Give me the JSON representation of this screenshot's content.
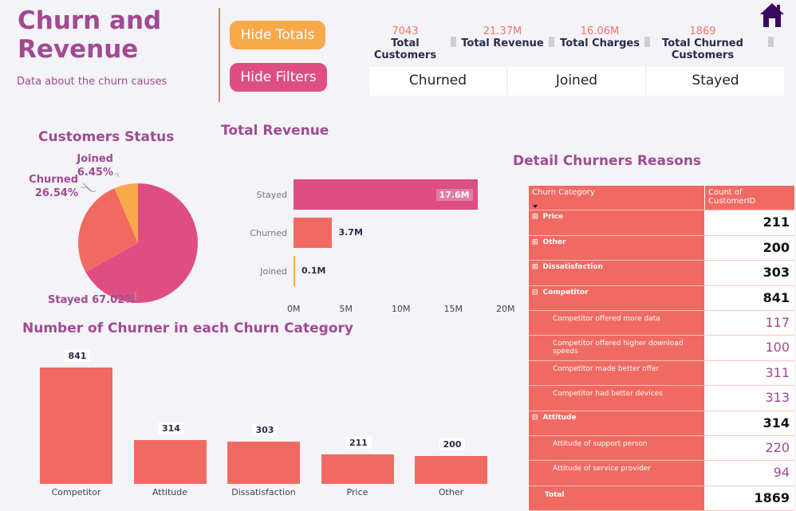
{
  "header": {
    "title": "Churn and Revenue",
    "subtitle": "Data about the churn causes",
    "hide_totals": "Hide Totals",
    "hide_filters": "Hide Filters",
    "home_icon": "home-icon"
  },
  "kpis": [
    {
      "value": "7043",
      "label": "Total Customers"
    },
    {
      "value": "21.37M",
      "label": "Total Revenue"
    },
    {
      "value": "16.06M",
      "label": "Total Charges"
    },
    {
      "value": "1869",
      "label": "Total Churned Customers"
    }
  ],
  "slicer": [
    "Churned",
    "Joined",
    "Stayed"
  ],
  "colors": {
    "accent": "#a04a93",
    "coral": "#f06a62",
    "pink": "#de4e83",
    "orange": "#f8a94a"
  },
  "chart_data": [
    {
      "type": "pie",
      "title": "Customers Status",
      "slices": [
        {
          "label": "Stayed",
          "value": 67.02,
          "display": "67.02%",
          "color": "#de4e83"
        },
        {
          "label": "Churned",
          "value": 26.54,
          "display": "26.54%",
          "color": "#f06a62"
        },
        {
          "label": "Joined",
          "value": 6.45,
          "display": "6.45%",
          "color": "#f8a94a"
        }
      ]
    },
    {
      "type": "bar",
      "orientation": "horizontal",
      "title": "Total Revenue",
      "categories": [
        "Stayed",
        "Churned",
        "Joined"
      ],
      "values": [
        17.6,
        3.7,
        0.1
      ],
      "labels": [
        "17.6M",
        "3.7M",
        "0.1M"
      ],
      "colors": [
        "#de4e83",
        "#f06a62",
        "#f8a94a"
      ],
      "xlim": [
        0,
        20
      ],
      "xticks": [
        "0M",
        "5M",
        "10M",
        "15M",
        "20M"
      ]
    },
    {
      "type": "bar",
      "title": "Number of Churner in each Churn Category",
      "categories": [
        "Competitor",
        "Attitude",
        "Dissatisfaction",
        "Price",
        "Other"
      ],
      "values": [
        841,
        314,
        303,
        211,
        200
      ]
    },
    {
      "type": "table",
      "title": "Detail Churners Reasons",
      "columns": [
        "Churn Category",
        "Count of CustomerID"
      ],
      "rows": [
        {
          "label": "Price",
          "value": "211",
          "level": "top",
          "toggle": "⊞"
        },
        {
          "label": "Other",
          "value": "200",
          "level": "top",
          "toggle": "⊞"
        },
        {
          "label": "Dissatisfaction",
          "value": "303",
          "level": "top",
          "toggle": "⊞"
        },
        {
          "label": "Competitor",
          "value": "841",
          "level": "top",
          "toggle": "⊟"
        },
        {
          "label": "Competitor offered more data",
          "value": "117",
          "level": "sub"
        },
        {
          "label": "Competitor offered higher download speeds",
          "value": "100",
          "level": "sub"
        },
        {
          "label": "Competitor made better offer",
          "value": "311",
          "level": "sub"
        },
        {
          "label": "Competitor had better devices",
          "value": "313",
          "level": "sub"
        },
        {
          "label": "Attitude",
          "value": "314",
          "level": "top",
          "toggle": "⊟"
        },
        {
          "label": "Attitude of support person",
          "value": "220",
          "level": "sub"
        },
        {
          "label": "Attitude of service provider",
          "value": "94",
          "level": "sub"
        },
        {
          "label": "Total",
          "value": "1869",
          "level": "total"
        }
      ]
    }
  ]
}
